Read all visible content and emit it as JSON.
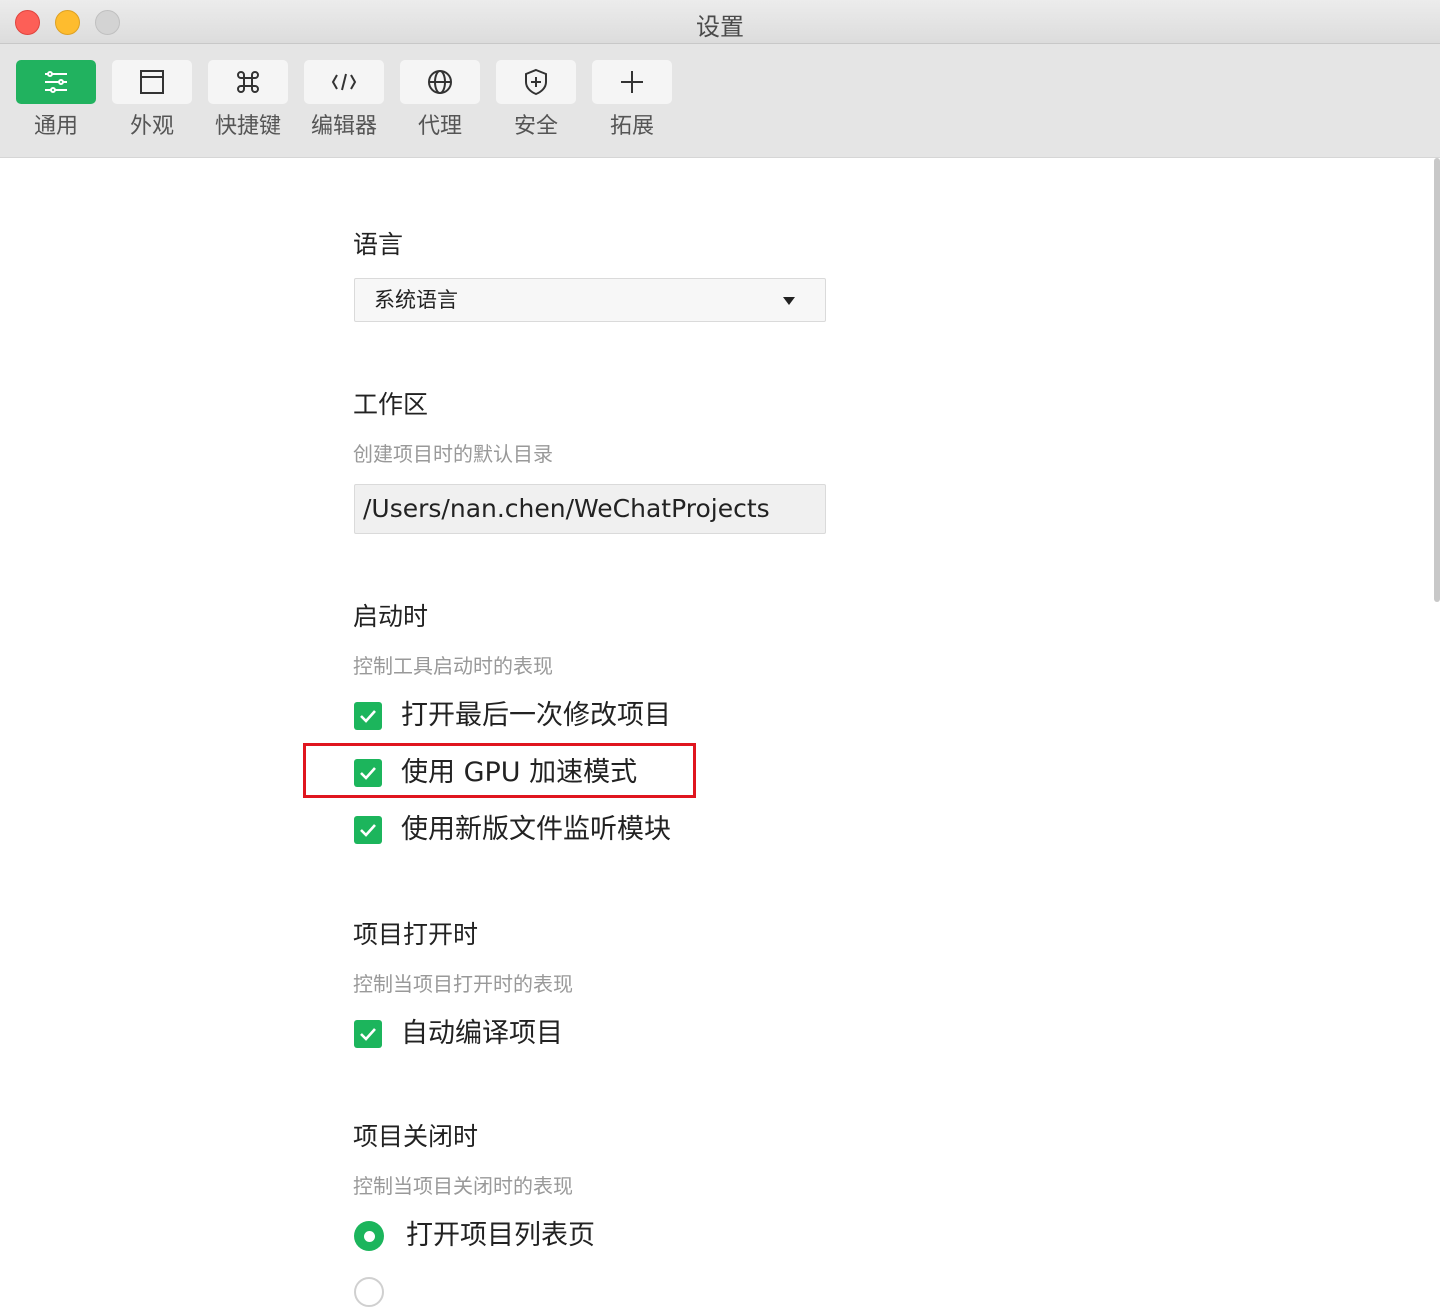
{
  "window": {
    "title": "设置"
  },
  "toolbar": {
    "tabs": [
      {
        "label": "通用",
        "icon": "sliders-icon",
        "active": true
      },
      {
        "label": "外观",
        "icon": "window-icon",
        "active": false
      },
      {
        "label": "快捷键",
        "icon": "command-key-icon",
        "active": false
      },
      {
        "label": "编辑器",
        "icon": "code-icon",
        "active": false
      },
      {
        "label": "代理",
        "icon": "globe-icon",
        "active": false
      },
      {
        "label": "安全",
        "icon": "shield-icon",
        "active": false
      },
      {
        "label": "拓展",
        "icon": "plus-icon",
        "active": false
      }
    ]
  },
  "language": {
    "title": "语言",
    "selected": "系统语言"
  },
  "workspace": {
    "title": "工作区",
    "desc": "创建项目时的默认目录",
    "path": "/Users/nan.chen/WeChatProjects"
  },
  "startup": {
    "title": "启动时",
    "desc": "控制工具启动时的表现",
    "options": [
      {
        "label": "打开最后一次修改项目",
        "checked": true
      },
      {
        "label": "使用 GPU 加速模式",
        "checked": true
      },
      {
        "label": "使用新版文件监听模块",
        "checked": true
      }
    ]
  },
  "project_open": {
    "title": "项目打开时",
    "desc": "控制当项目打开时的表现",
    "options": [
      {
        "label": "自动编译项目",
        "checked": true
      }
    ]
  },
  "project_close": {
    "title": "项目关闭时",
    "desc": "控制当项目关闭时的表现",
    "options": [
      {
        "label": "打开项目列表页",
        "selected": true
      },
      {
        "label": "",
        "selected": false
      }
    ]
  },
  "colors": {
    "accent": "#21b25f",
    "checkbox": "#1cb55c",
    "highlight": "#e0161f"
  }
}
